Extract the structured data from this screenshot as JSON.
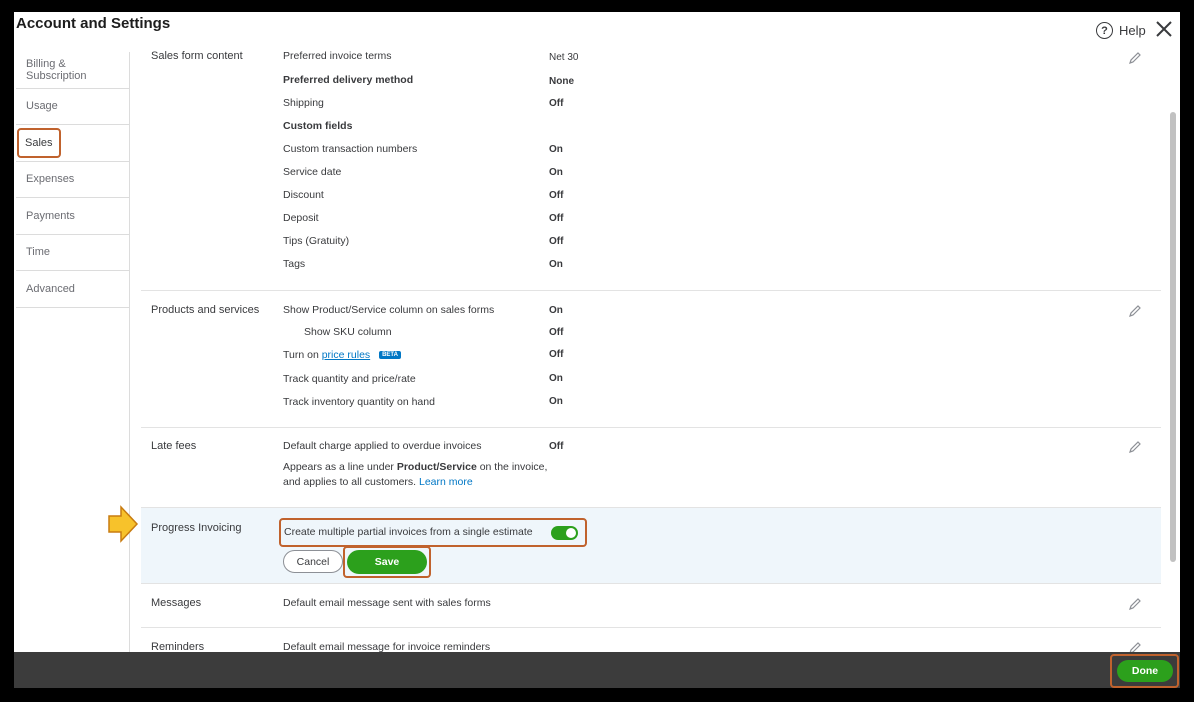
{
  "window": {
    "title": "Account and Settings",
    "help_label": "Help"
  },
  "sidebar": {
    "items": [
      {
        "label": "Billing & Subscription"
      },
      {
        "label": "Usage"
      },
      {
        "label": "Sales",
        "active": true
      },
      {
        "label": "Expenses"
      },
      {
        "label": "Payments"
      },
      {
        "label": "Time"
      },
      {
        "label": "Advanced"
      }
    ]
  },
  "sales_form_content": {
    "title": "Sales form content",
    "rows": [
      {
        "label": "Preferred invoice terms",
        "value": "Net 30"
      },
      {
        "label": "Preferred delivery method",
        "value": "None"
      },
      {
        "label": "Shipping",
        "value": "Off"
      },
      {
        "label": "Custom fields",
        "value": ""
      },
      {
        "label": "Custom transaction numbers",
        "value": "On"
      },
      {
        "label": "Service date",
        "value": "On"
      },
      {
        "label": "Discount",
        "value": "Off"
      },
      {
        "label": "Deposit",
        "value": "Off"
      },
      {
        "label": "Tips (Gratuity)",
        "value": "Off"
      },
      {
        "label": "Tags",
        "value": "On"
      }
    ]
  },
  "products_services": {
    "title": "Products and services",
    "rows": [
      {
        "label": "Show Product/Service column on sales forms",
        "value": "On"
      },
      {
        "label": "Show SKU column",
        "value": "Off"
      },
      {
        "label_prefix": "Turn on",
        "link": "price rules",
        "badge": "BETA",
        "value": "Off"
      },
      {
        "label": "Track quantity and price/rate",
        "value": "On"
      },
      {
        "label": "Track inventory quantity on hand",
        "value": "On"
      }
    ]
  },
  "late_fees": {
    "title": "Late fees",
    "row_label": "Default charge applied to overdue invoices",
    "row_value": "Off",
    "note_1": "Appears as a line under",
    "note_bold": "Product/Service",
    "note_2": "on the invoice,",
    "note_3": "and applies to all customers.",
    "note_link": "Learn more"
  },
  "progress_invoicing": {
    "title": "Progress Invoicing",
    "row_label": "Create multiple partial invoices from a single estimate",
    "toggle_on": true,
    "cancel_label": "Cancel",
    "save_label": "Save"
  },
  "messages": {
    "title": "Messages",
    "row_label": "Default email message sent with sales forms"
  },
  "reminders": {
    "title": "Reminders",
    "row_label": "Default email message for invoice reminders"
  },
  "footer": {
    "done_label": "Done"
  },
  "colors": {
    "accent_green": "#2ca01c",
    "highlight_orange": "#c0622d",
    "link_blue": "#0077c5",
    "arrow_yellow": "#f7c22b"
  }
}
